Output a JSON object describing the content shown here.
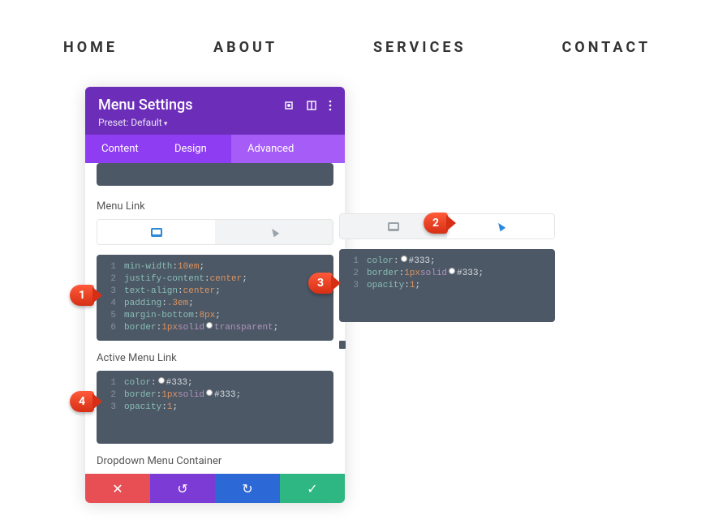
{
  "nav": {
    "items": [
      "HOME",
      "ABOUT",
      "SERVICES",
      "CONTACT"
    ]
  },
  "panel": {
    "title": "Menu Settings",
    "preset": "Preset: Default",
    "tabs": [
      "Content",
      "Design",
      "Advanced"
    ],
    "active_tab": 2
  },
  "sections": {
    "menu_link": {
      "label": "Menu Link",
      "code": [
        [
          [
            "prop",
            "min-width"
          ],
          [
            "punc",
            ": "
          ],
          [
            "val",
            "10em"
          ],
          [
            "punc",
            ";"
          ]
        ],
        [
          [
            "prop",
            "justify-content"
          ],
          [
            "punc",
            ":"
          ],
          [
            "val",
            "center"
          ],
          [
            "punc",
            ";"
          ]
        ],
        [
          [
            "prop",
            "text-align"
          ],
          [
            "punc",
            ":"
          ],
          [
            "val",
            "center"
          ],
          [
            "punc",
            ";"
          ]
        ],
        [
          [
            "prop",
            "padding"
          ],
          [
            "punc",
            ": "
          ],
          [
            "val",
            ".3em"
          ],
          [
            "punc",
            ";"
          ]
        ],
        [
          [
            "prop",
            "margin-bottom"
          ],
          [
            "punc",
            ": "
          ],
          [
            "val",
            "8px"
          ],
          [
            "punc",
            ";"
          ]
        ],
        [
          [
            "prop",
            "border"
          ],
          [
            "punc",
            ": "
          ],
          [
            "val",
            "1px "
          ],
          [
            "kw",
            "solid "
          ],
          [
            "swatch",
            ""
          ],
          [
            "kw",
            "transparent"
          ],
          [
            "punc",
            ";"
          ]
        ]
      ]
    },
    "active_menu_link": {
      "label": "Active Menu Link",
      "code": [
        [
          [
            "prop",
            "color"
          ],
          [
            "punc",
            ": "
          ],
          [
            "swatch",
            ""
          ],
          [
            "hex",
            "#333"
          ],
          [
            "punc",
            ";"
          ]
        ],
        [
          [
            "prop",
            "border"
          ],
          [
            "punc",
            ": "
          ],
          [
            "val",
            "1px "
          ],
          [
            "kw",
            "solid "
          ],
          [
            "swatch",
            ""
          ],
          [
            "hex",
            "#333"
          ],
          [
            "punc",
            ";"
          ]
        ],
        [
          [
            "prop",
            "opacity"
          ],
          [
            "punc",
            ":"
          ],
          [
            "val",
            "1"
          ],
          [
            "punc",
            ";"
          ]
        ]
      ]
    },
    "dropdown": {
      "label": "Dropdown Menu Container"
    }
  },
  "aux": {
    "code": [
      [
        [
          "prop",
          "color"
        ],
        [
          "punc",
          ": "
        ],
        [
          "swatch",
          ""
        ],
        [
          "hex",
          "#333"
        ],
        [
          "punc",
          ";"
        ]
      ],
      [
        [
          "prop",
          "border"
        ],
        [
          "punc",
          ": "
        ],
        [
          "val",
          "1px "
        ],
        [
          "kw",
          "solid "
        ],
        [
          "swatch",
          ""
        ],
        [
          "hex",
          "#333"
        ],
        [
          "punc",
          ";"
        ]
      ],
      [
        [
          "prop",
          "opacity"
        ],
        [
          "punc",
          ":"
        ],
        [
          "val",
          "1"
        ],
        [
          "punc",
          ";"
        ]
      ]
    ]
  },
  "badges": {
    "b1": "1",
    "b2": "2",
    "b3": "3",
    "b4": "4"
  }
}
